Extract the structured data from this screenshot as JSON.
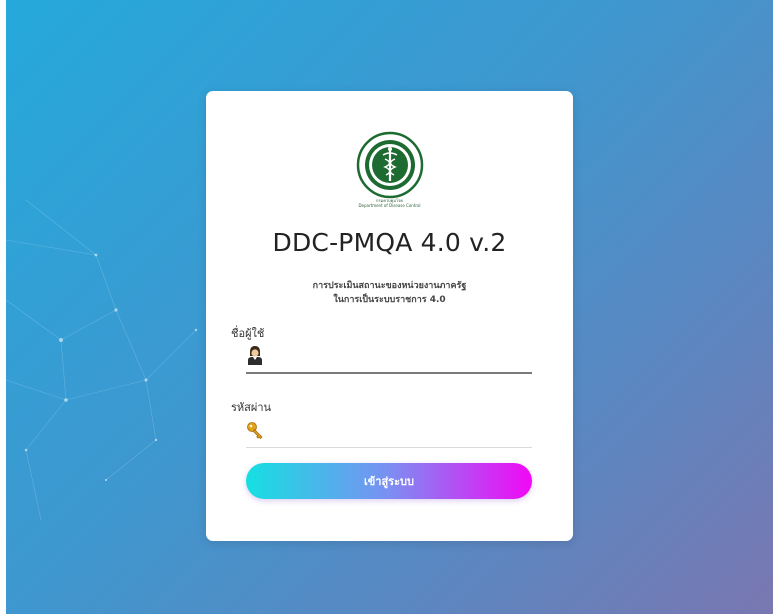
{
  "app": {
    "title": "DDC-PMQA 4.0 v.2",
    "subtitle_line1": "การประเมินสถานะของหน่วยงานภาครัฐ",
    "subtitle_line2": "ในการเป็นระบบราชการ 4.0"
  },
  "logo": {
    "ring_text": "กระทรวงสาธารณสุข · MINISTRY OF PUBLIC HEALTH",
    "caption_th": "กรมควบคุมโรค",
    "caption_en": "Department of Disease Control",
    "color": "#1e6b32"
  },
  "form": {
    "username_label": "ชื่อผู้ใช้",
    "username_value": "",
    "username_icon": "user-icon",
    "password_label": "รหัสผ่าน",
    "password_value": "",
    "password_icon": "key-icon",
    "submit_label": "เข้าสู่ระบบ"
  },
  "colors": {
    "background_start": "#25a9db",
    "background_end": "#7a77b1",
    "button_start": "#15e0e2",
    "button_end": "#f208f5"
  }
}
